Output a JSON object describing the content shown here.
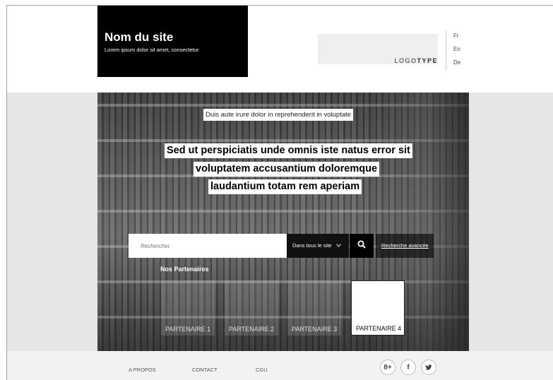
{
  "header": {
    "site_name": "Nom du site",
    "site_tagline": "Lorem ipsum dolor sit amet, consectetur",
    "logo": {
      "light": "LOGO",
      "bold": "TYPE"
    },
    "languages": [
      "Fr",
      "En",
      "De"
    ]
  },
  "hero": {
    "kicker": "Duis aute irure dolor in reprehenderit in voluptate",
    "headline_lines": [
      "Sed ut perspiciatis unde omnis iste natus error sit",
      "voluptatem accusantium doloremque",
      "laudantium totam rem aperiam"
    ]
  },
  "search": {
    "placeholder": "Rechercher",
    "scope_label": "Dans tous le site",
    "scope_icon": "chevron-down-icon",
    "button_icon": "search-icon",
    "advanced_label": "Recherche avancée"
  },
  "partners": {
    "title": "Nos Partenaires",
    "items": [
      "PARTENAIRE 1",
      "PARTENAIRE 2",
      "PARTENAIRE 3",
      "PARTENAIRE 4"
    ],
    "active_index": 3
  },
  "footer": {
    "links": [
      "A PROPOS",
      "CONTACT",
      "CGU"
    ],
    "social": [
      {
        "icon": "google-plus-icon",
        "glyph": "8+"
      },
      {
        "icon": "facebook-icon",
        "glyph": "f"
      },
      {
        "icon": "twitter-icon",
        "glyph": ""
      }
    ]
  },
  "colors": {
    "accent_border": "#e8847a",
    "brand_bg": "#000000",
    "band_bg": "#e6e6e6"
  }
}
